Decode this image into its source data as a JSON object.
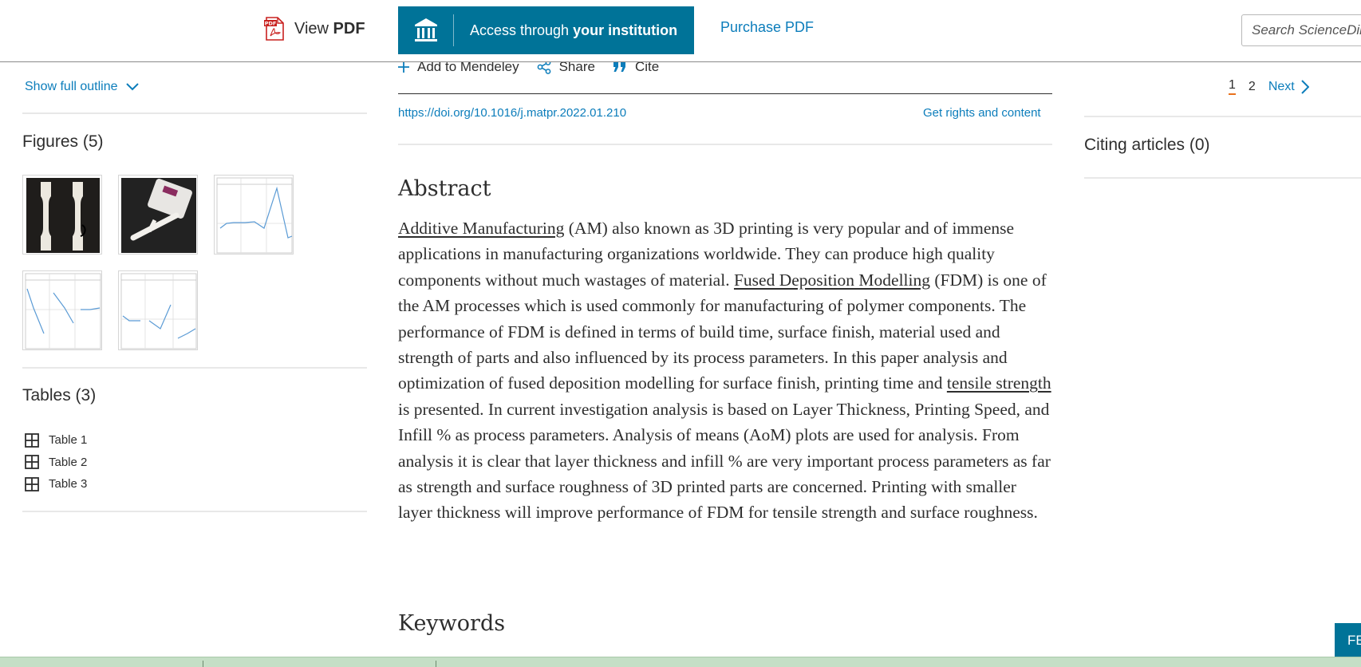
{
  "topbar": {
    "view_pdf_prefix": "View ",
    "view_pdf_bold": "PDF",
    "access_prefix": "Access through ",
    "access_bold": "your institution",
    "purchase_pdf": "Purchase PDF",
    "search_placeholder": "Search ScienceDirect"
  },
  "left": {
    "show_outline": "Show full outline",
    "figures_title": "Figures (5)",
    "tables_title": "Tables (3)",
    "tables": [
      "Table 1",
      "Table 2",
      "Table 3"
    ]
  },
  "article": {
    "actions": {
      "mendeley": "Add to Mendeley",
      "share": "Share",
      "cite": "Cite"
    },
    "doi": "https://doi.org/10.1016/j.matpr.2022.01.210",
    "rights": "Get rights and content",
    "abstract_heading": "Abstract",
    "abstract": {
      "t1": "Additive Manufacturing",
      "s1": " (AM) also known as 3D printing is very popular and of immense applications in manufacturing organizations worldwide. They can produce high quality components without much wastages of material. ",
      "t2": "Fused Deposition Modelling",
      "s2": " (FDM) is one of the AM processes which is used commonly for manufacturing of polymer components. The performance of FDM is defined in terms of build time, surface finish, material used and strength of parts and also influenced by its process parameters. In this paper analysis and optimization of fused deposition modelling for surface finish, printing time and ",
      "t3": "tensile strength",
      "s3": " is presented. In current investigation analysis is based on Layer Thickness, Printing Speed, and Infill % as process parameters. Analysis of means (AoM) plots are used for analysis. From analysis it is clear that layer thickness and infill % are very important process parameters as far as strength and surface roughness of 3D printed parts are concerned. Printing with smaller layer thickness will improve performance of FDM for tensile strength and surface roughness."
    },
    "keywords_heading": "Keywords"
  },
  "right": {
    "page_current": "1",
    "page_2": "2",
    "next": "Next",
    "citing": "Citing articles (0)",
    "feedback": "FE"
  },
  "colors": {
    "brand": "#007398",
    "link": "#0c7dbb",
    "accent_orange": "#e9711c"
  }
}
